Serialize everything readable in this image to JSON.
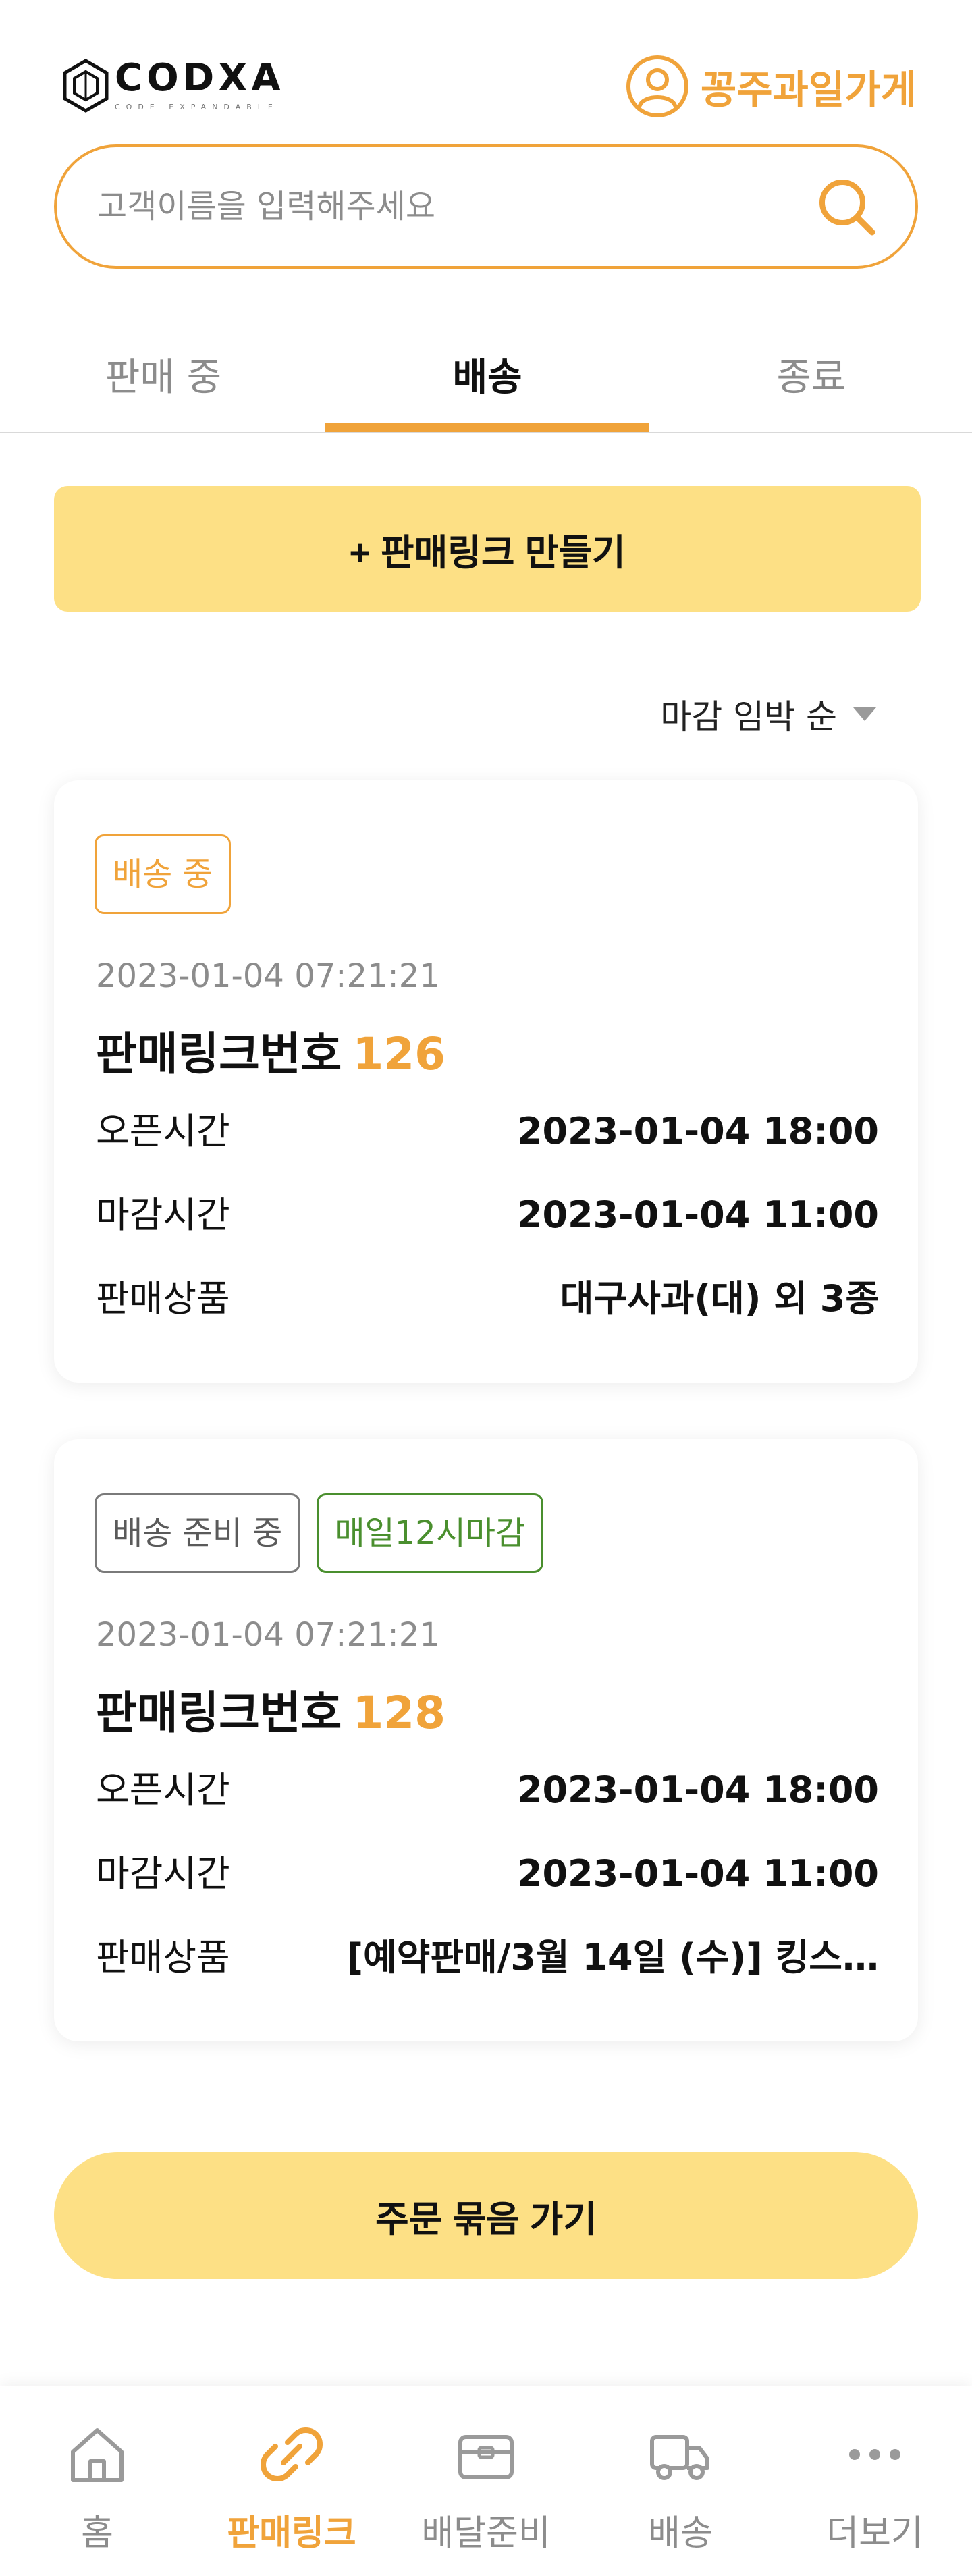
{
  "header": {
    "logo_text": "CODXA",
    "logo_sub": "CODE EXPANDABLE",
    "store_name": "꽁주과일가게"
  },
  "search": {
    "placeholder": "고객이름을 입력해주세요",
    "value": ""
  },
  "tabs": [
    {
      "label": "판매 중",
      "active": false
    },
    {
      "label": "배송",
      "active": true
    },
    {
      "label": "종료",
      "active": false
    }
  ],
  "make_link_label": "+ 판매링크 만들기",
  "sort": {
    "label": "마감 임박 순"
  },
  "cards": [
    {
      "badges": [
        "배송 중"
      ],
      "date": "2023-01-04  07:21:21",
      "title_prefix": "판매링크번호",
      "number": "126",
      "rows": [
        {
          "label": "오픈시간",
          "value": "2023-01-04 18:00"
        },
        {
          "label": "마감시간",
          "value": "2023-01-04 11:00"
        },
        {
          "label": "판매상품",
          "value": "대구사과(대) 외 3종"
        }
      ]
    },
    {
      "badges": [
        "배송 준비 중",
        "매일12시마감"
      ],
      "date": "2023-01-04  07:21:21",
      "title_prefix": "판매링크번호",
      "number": "128",
      "rows": [
        {
          "label": "오픈시간",
          "value": "2023-01-04 18:00"
        },
        {
          "label": "마감시간",
          "value": "2023-01-04 11:00"
        },
        {
          "label": "판매상품",
          "value": "[예약판매/3월 14일 (수)] 킹스…"
        }
      ]
    }
  ],
  "group_button_label": "주문 묶음 가기",
  "nav": [
    {
      "label": "홈",
      "icon": "home-icon",
      "active": false
    },
    {
      "label": "판매링크",
      "icon": "link-icon",
      "active": true
    },
    {
      "label": "배달준비",
      "icon": "box-icon",
      "active": false
    },
    {
      "label": "배송",
      "icon": "truck-icon",
      "active": false
    },
    {
      "label": "더보기",
      "icon": "more-icon",
      "active": false
    }
  ],
  "colors": {
    "accent": "#F0A33A",
    "button_yellow": "#FDE085",
    "green": "#4A8F2E",
    "inactive": "#8c8c8c"
  }
}
